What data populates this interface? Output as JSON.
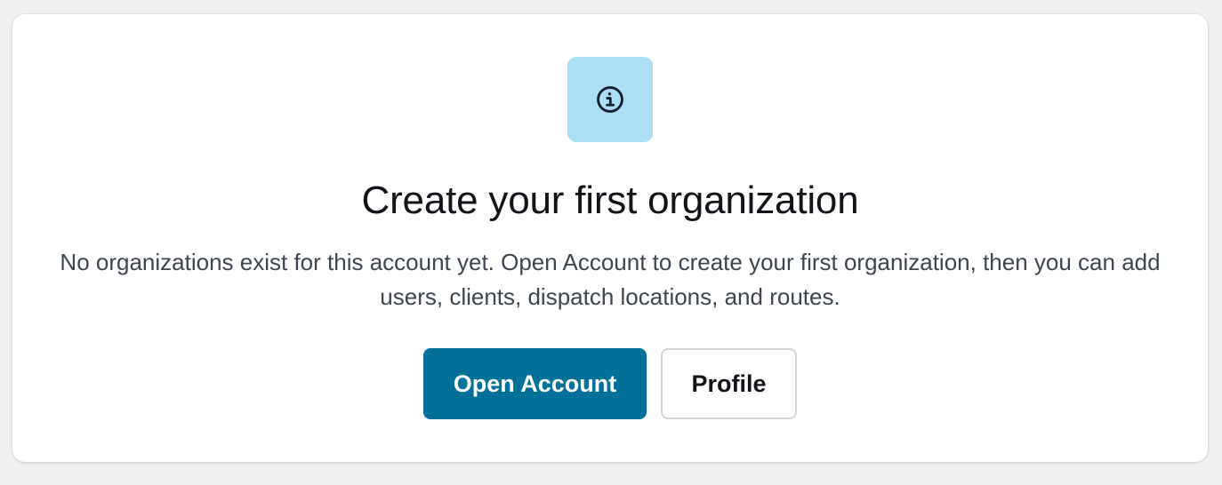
{
  "colors": {
    "page_background": "#eff1f0",
    "card_background": "#ffffff",
    "icon_tile_background": "#acdff5",
    "icon_stroke": "#12202c",
    "primary_button": "#02719a",
    "primary_button_text": "#ffffff",
    "title_text": "#111418",
    "body_text": "#3d4650"
  },
  "empty_state": {
    "icon": "info-icon",
    "title": "Create your first organization",
    "description": "No organizations exist for this account yet. Open Account to create your first organization, then you can add users, clients, dispatch locations, and routes.",
    "primary_action_label": "Open Account",
    "secondary_action_label": "Profile"
  }
}
